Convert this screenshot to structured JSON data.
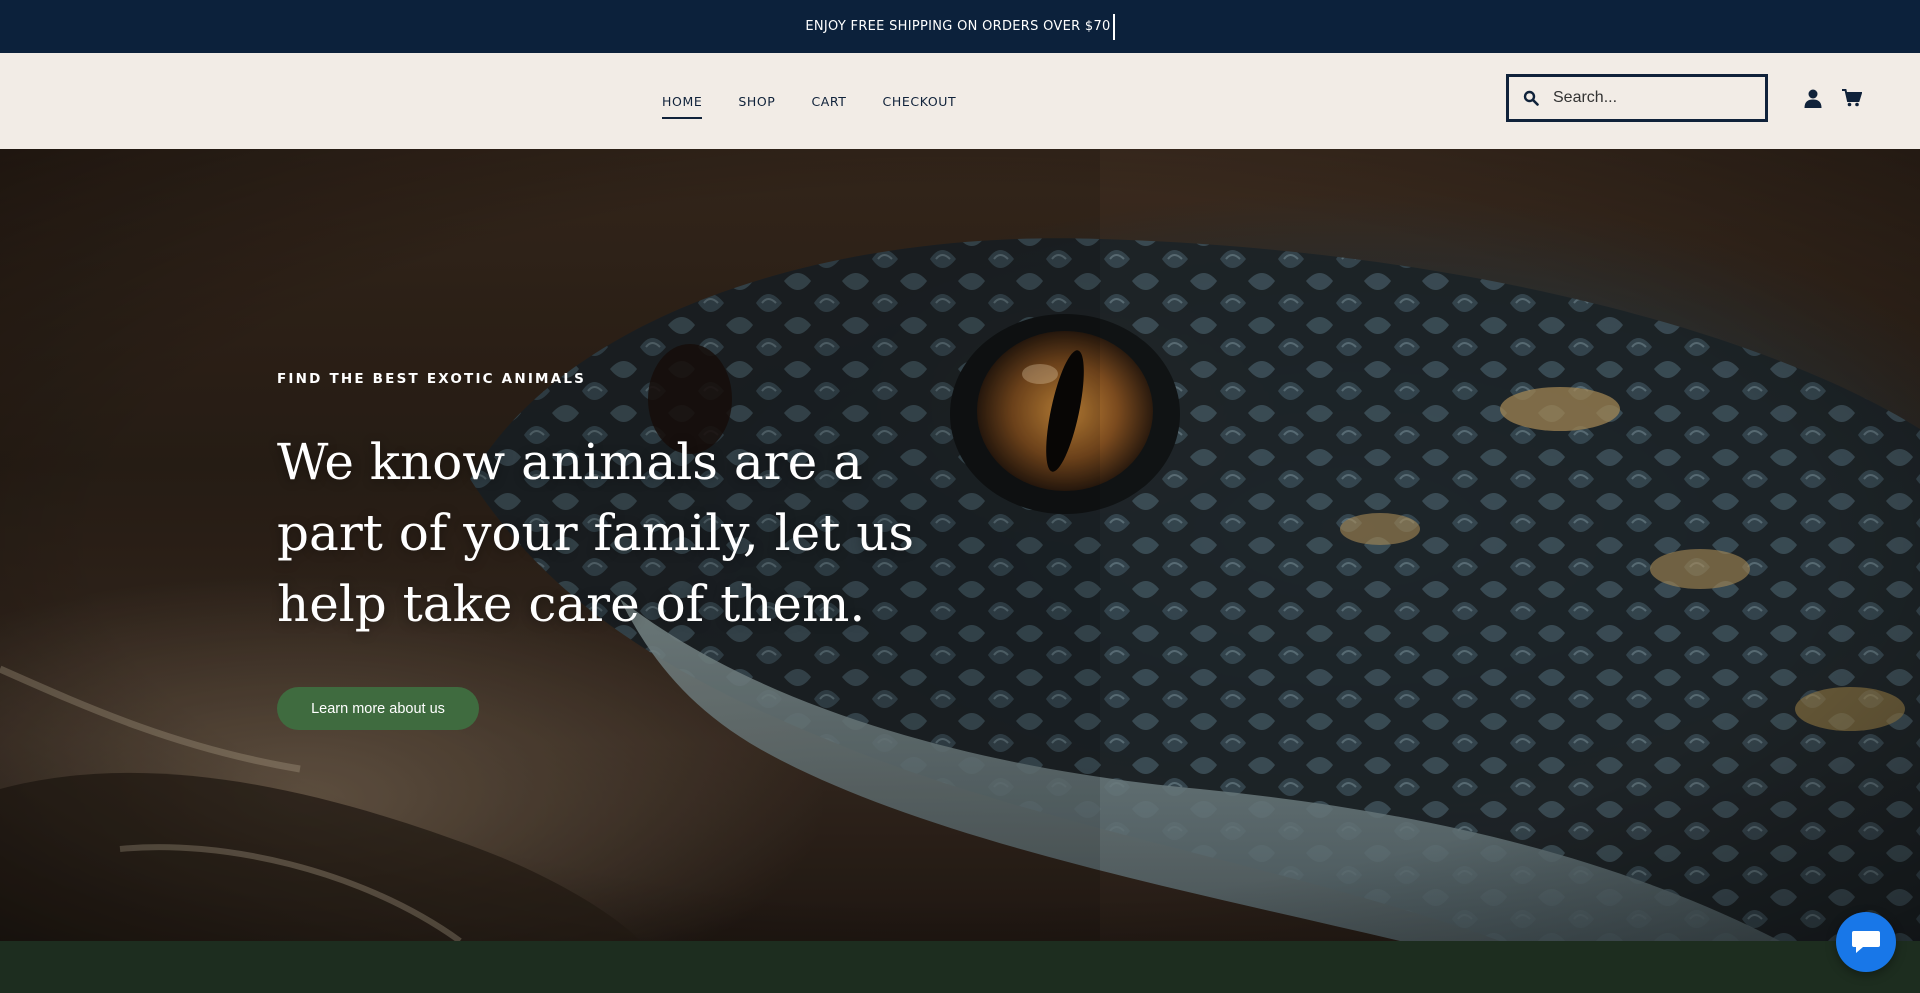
{
  "announcement": {
    "text": "ENJOY FREE SHIPPING ON ORDERS OVER $70"
  },
  "nav": {
    "items": [
      {
        "label": "HOME",
        "active": true
      },
      {
        "label": "SHOP"
      },
      {
        "label": "CART"
      },
      {
        "label": "CHECKOUT"
      }
    ]
  },
  "search": {
    "placeholder": "Search..."
  },
  "icons": {
    "search": "search-icon",
    "account": "user-icon",
    "cart": "cart-icon",
    "chat": "chat-icon"
  },
  "hero": {
    "eyebrow": "FIND THE BEST EXOTIC ANIMALS",
    "headline": "We know animals are a part of your family, let us help take care of them.",
    "cta_label": "Learn more about us"
  },
  "colors": {
    "announcement_bg": "#0c213b",
    "header_bg": "#f2ece6",
    "cta_bg": "#3f6b3f",
    "band_bg": "#1d2d1f",
    "chat_bg": "#1877e8"
  }
}
